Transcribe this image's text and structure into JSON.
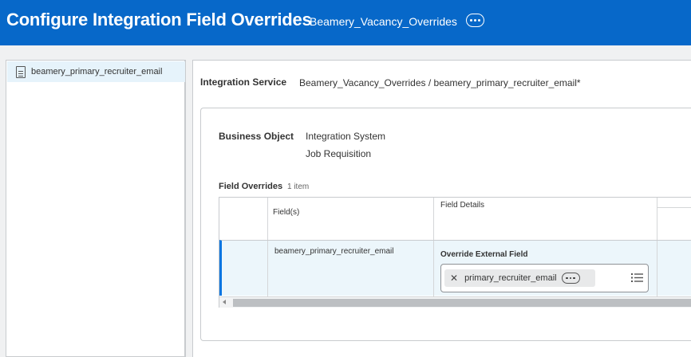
{
  "header": {
    "title": "Configure Integration Field Overrides",
    "subtitle": "Beamery_Vacancy_Overrides",
    "more_icon": "ellipsis-icon"
  },
  "colors": {
    "header_bg": "#0768c9",
    "selected_row": "#ecf6fb",
    "row_accent": "#0875e1"
  },
  "sidebar": {
    "items": [
      {
        "label": "beamery_primary_recruiter_email",
        "icon": "document-icon"
      }
    ]
  },
  "form": {
    "integration_service_label": "Integration Service",
    "integration_service_value": "Beamery_Vacancy_Overrides / beamery_primary_recruiter_email*",
    "business_object_label": "Business Object",
    "business_object_values": [
      "Integration System",
      "Job Requisition"
    ],
    "field_overrides_label": "Field Overrides",
    "field_overrides_count": "1 item"
  },
  "grid": {
    "columns": [
      "Field(s)",
      "Field Details"
    ],
    "rows": [
      {
        "field": "beamery_primary_recruiter_email",
        "details_label": "Override External Field",
        "chip_value": "primary_recruiter_email"
      }
    ]
  }
}
